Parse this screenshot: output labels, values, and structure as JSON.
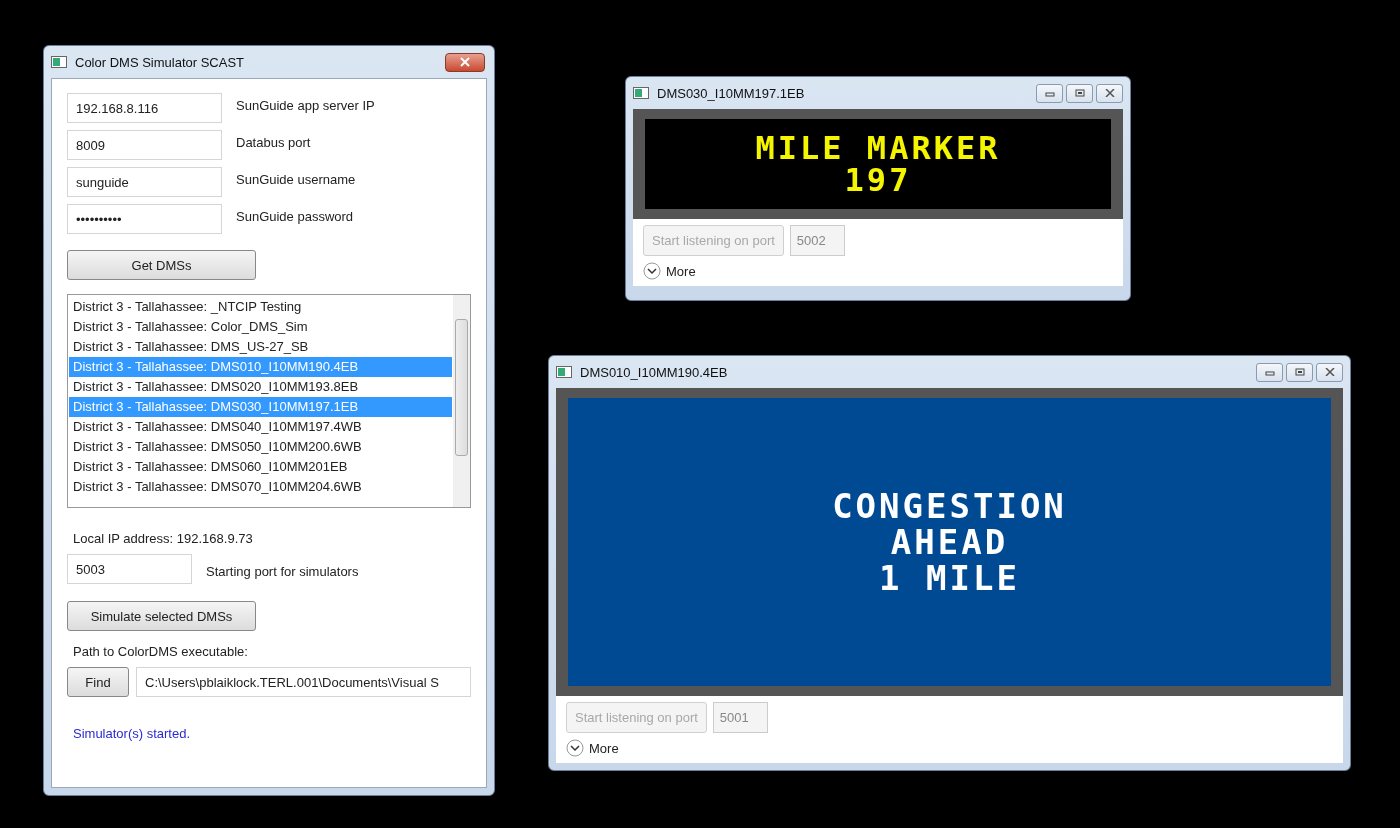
{
  "main_window": {
    "title": "Color DMS Simulator SCAST",
    "fields": [
      {
        "value": "192.168.8.116",
        "label": "SunGuide app server IP",
        "kind": "text"
      },
      {
        "value": "8009",
        "label": "Databus port",
        "kind": "text"
      },
      {
        "value": "sunguide",
        "label": "SunGuide username",
        "kind": "text"
      },
      {
        "value": "••••••••••",
        "label": "SunGuide password",
        "kind": "password"
      }
    ],
    "get_button": "Get DMSs",
    "dms_list": [
      {
        "label": "District 3 - Tallahassee: _NTCIP Testing",
        "selected": false
      },
      {
        "label": "District 3 - Tallahassee: Color_DMS_Sim",
        "selected": false
      },
      {
        "label": "District 3 - Tallahassee: DMS_US-27_SB",
        "selected": false
      },
      {
        "label": "District 3 - Tallahassee: DMS010_I10MM190.4EB",
        "selected": true
      },
      {
        "label": "District 3 - Tallahassee: DMS020_I10MM193.8EB",
        "selected": false
      },
      {
        "label": "District 3 - Tallahassee: DMS030_I10MM197.1EB",
        "selected": true
      },
      {
        "label": "District 3 - Tallahassee: DMS040_I10MM197.4WB",
        "selected": false
      },
      {
        "label": "District 3 - Tallahassee: DMS050_I10MM200.6WB",
        "selected": false
      },
      {
        "label": "District 3 - Tallahassee: DMS060_I10MM201EB",
        "selected": false
      },
      {
        "label": "District 3 - Tallahassee: DMS070_I10MM204.6WB",
        "selected": false
      }
    ],
    "local_ip": "Local IP address: 192.168.9.73",
    "start_port": {
      "value": "5003",
      "label": "Starting port for simulators"
    },
    "simulate_button": "Simulate selected DMSs",
    "path_label": "Path to ColorDMS executable:",
    "find_button": "Find",
    "path_value": "C:\\Users\\pblaiklock.TERL.001\\Documents\\Visual S",
    "status": "Simulator(s) started."
  },
  "sign_windows": [
    {
      "title": "DMS030_I10MM197.1EB",
      "lines": [
        "MILE MARKER",
        "197"
      ],
      "color": "#f5f500",
      "kind": "monochrome",
      "listen_button": "Start listening on port",
      "disabled": true,
      "port": "5002",
      "more": "More",
      "expanded": false
    },
    {
      "title": "DMS010_I10MM190.4EB",
      "lines": [
        "CONGESTION",
        "AHEAD",
        "1 MILE"
      ],
      "color": "#ffffff",
      "kind": "fullcolor",
      "listen_button": "Start listening on port",
      "disabled": true,
      "port": "5001",
      "more": "More",
      "expanded": false
    }
  ]
}
